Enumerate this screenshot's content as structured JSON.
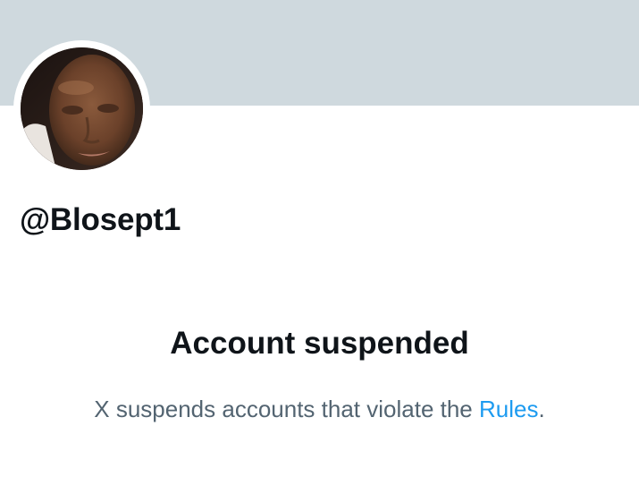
{
  "profile": {
    "handle": "@Blosept1",
    "avatar_alt": "profile photo"
  },
  "suspension": {
    "title": "Account suspended",
    "message_prefix": "X suspends accounts that violate the ",
    "rules_link_label": "Rules",
    "message_suffix": "."
  },
  "colors": {
    "banner": "#cfd9de",
    "text_primary": "#0f1419",
    "text_secondary": "#536471",
    "link": "#1d9bf0"
  }
}
